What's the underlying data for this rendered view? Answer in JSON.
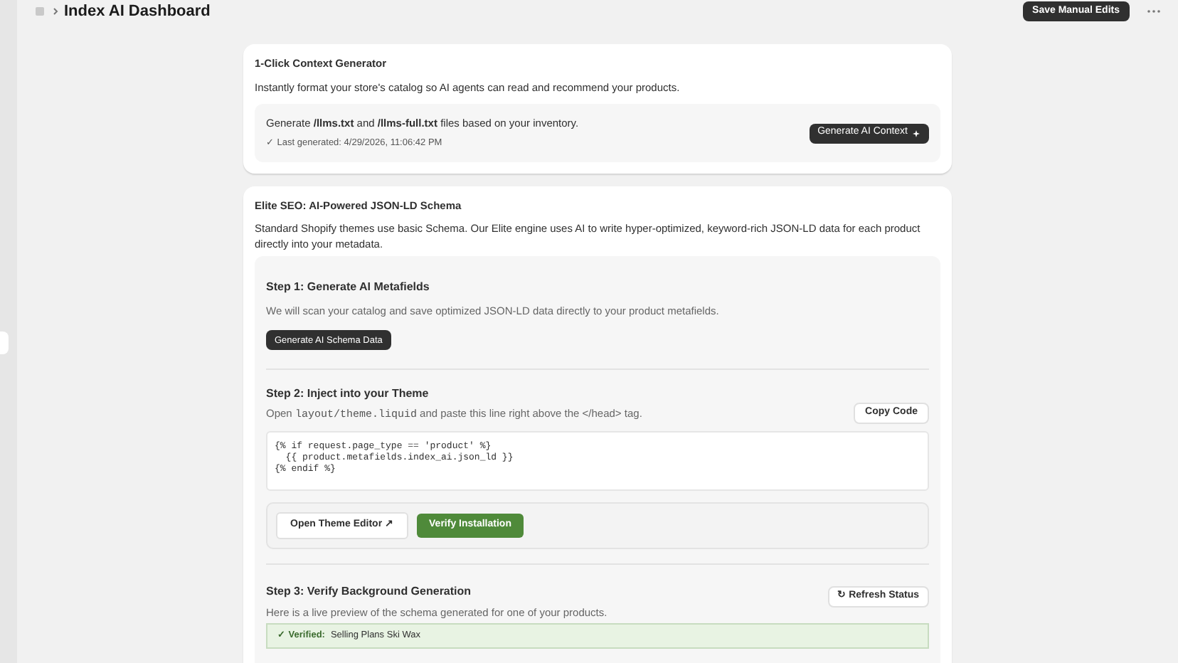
{
  "header": {
    "title": "Index AI Dashboard",
    "button": "Save Manual Edits"
  },
  "context_card": {
    "title": "1-Click Context Generator",
    "description": "Instantly format your store's catalog so AI agents can read and recommend your products.",
    "panel": {
      "text": "Generate **/llms.txt** and **/llms-full.txt** files based on your inventory.",
      "status": "✓ Last generated: 4/29/2026, 11:06:42 PM",
      "button": "Generate AI Context"
    }
  },
  "schema_card": {
    "title": "Elite SEO: AI-Powered JSON-LD Schema",
    "description": "Standard Shopify themes use basic Schema. Our Elite engine uses AI to write hyper-optimized, keyword-rich JSON-LD data for each product directly into your metadata.",
    "step1": {
      "title": "Step 1: Generate AI Metafields",
      "description": "We will scan your catalog and save optimized JSON-LD data directly to your product metafields.",
      "button": "Generate AI Schema Data"
    },
    "step2": {
      "title": "Step 2: Inject into your Theme",
      "description": [
        {
          "kind": "text",
          "text": "Open "
        },
        {
          "kind": "code",
          "text": "layout/theme.liquid"
        },
        {
          "kind": "text",
          "text": " and paste this line right above the </head> tag."
        }
      ],
      "button": "Copy Code",
      "code": [
        "{% if request.page_type == 'product' %}",
        "  {{ product.metafields.index_ai.json_ld }}",
        "{% endif %}"
      ],
      "actions": [
        {
          "kind": "outline",
          "label": "Open Theme Editor ↗"
        },
        {
          "kind": "primary",
          "label": "Verify Installation"
        }
      ]
    },
    "step3": {
      "title": "Step 3: Verify Background Generation",
      "description": "Here is a live preview of the schema generated for one of your products.",
      "button": "↻ Refresh Status",
      "verified_label": "✓ Verified:",
      "verified_value": "Selling Plans Ski Wax"
    }
  }
}
